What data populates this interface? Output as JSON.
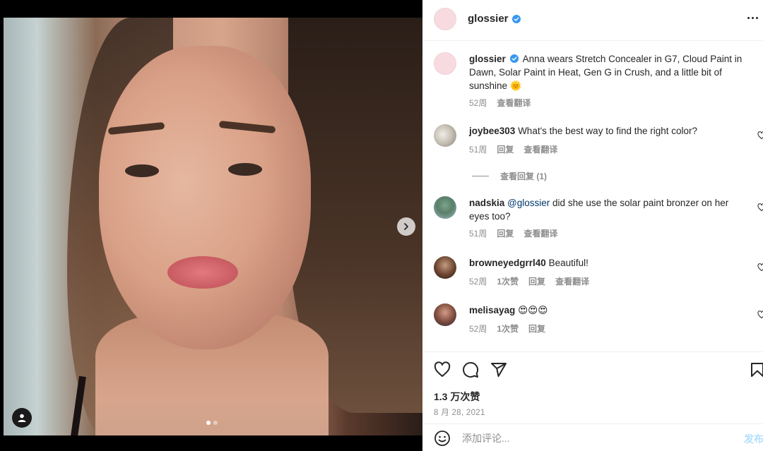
{
  "post": {
    "slide_count": 2,
    "active_slide": 1,
    "icons": {
      "next": "chevron-right-icon",
      "user_tag": "user-icon"
    }
  },
  "header": {
    "username": "glossier",
    "verified": true,
    "more_icon": "more-horizontal-icon"
  },
  "caption": {
    "username": "glossier",
    "text": "Anna wears Stretch Concealer in G7, Cloud Paint in Dawn, Solar Paint in Heat, Gen G in Crush, and a little bit of sunshine 🌞",
    "time": "52周",
    "translate": "查看翻译"
  },
  "comments": [
    {
      "username": "joybee303",
      "mention": "",
      "text": "What's the best way to find the right color?",
      "time": "51周",
      "likes": "",
      "reply": "回复",
      "translate": "查看翻译"
    },
    {
      "username": "nadskia",
      "mention": "@glossier",
      "text": "did she use the solar paint bronzer on her eyes too?",
      "time": "51周",
      "likes": "",
      "reply": "回复",
      "translate": "查看翻译"
    },
    {
      "username": "browneyedgrrl40",
      "mention": "",
      "text": "Beautiful!",
      "time": "52周",
      "likes": "1次赞",
      "reply": "回复",
      "translate": "查看翻译"
    },
    {
      "username": "melisayag",
      "mention": "",
      "text": "😍😍😍",
      "time": "52周",
      "likes": "1次赞",
      "reply": "回复",
      "translate": ""
    }
  ],
  "view_replies": "查看回复 (1)",
  "actions": {
    "icons": [
      "heart-icon",
      "comment-icon",
      "share-icon",
      "bookmark-icon"
    ]
  },
  "likes_count": "1.3 万次赞",
  "post_date": "8 月 28, 2021",
  "add_comment": {
    "placeholder": "添加评论...",
    "post_label": "发布",
    "emoji_icon": "emoji-icon"
  },
  "colors": {
    "verified_blue": "#3897f0",
    "muted_text": "#8e8e8e",
    "post_button": "#b2dffc"
  }
}
